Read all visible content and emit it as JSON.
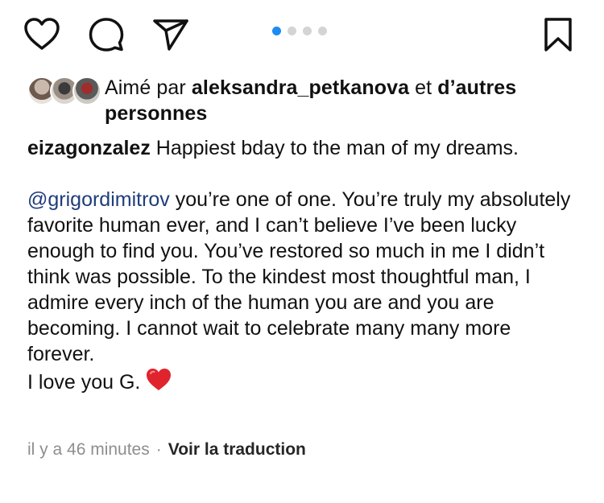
{
  "actions": {
    "like_icon": "heart-outline-icon",
    "comment_icon": "speech-bubble-icon",
    "share_icon": "paper-plane-icon",
    "save_icon": "bookmark-outline-icon",
    "carousel": {
      "count": 4,
      "active_index": 0
    },
    "active_dot_color": "#1d8bf0"
  },
  "likes": {
    "prefix": "Aimé par",
    "user": "aleksandra_petkanova",
    "conjunction": "et",
    "others": "d’autres personnes"
  },
  "caption": {
    "username": "eizagonzalez",
    "line1": "Happiest bday to the man of my dreams.",
    "mention": "@grigordimitrov",
    "body": "you’re one of one. You’re truly my absolutely favorite human ever, and I can’t believe I’ve been lucky enough to find you. You’ve restored so much in me I didn’t think was possible. To the kindest most thoughtful man, I admire every inch of the human you are and you are becoming. I cannot wait to celebrate many many more forever.",
    "closing": "I love you G."
  },
  "meta": {
    "time": "il y a 46 minutes",
    "separator": "·",
    "translate": "Voir la traduction"
  }
}
